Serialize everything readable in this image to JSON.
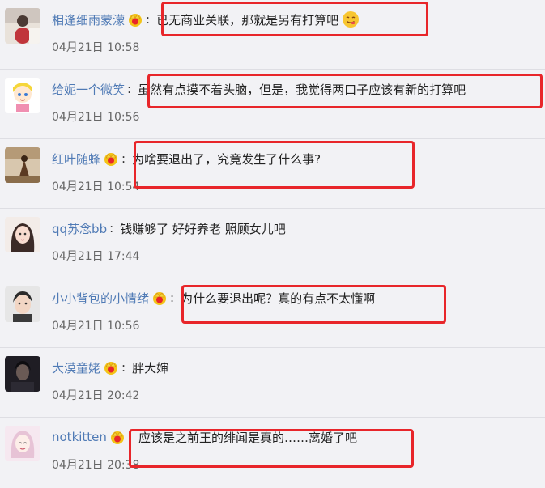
{
  "colors": {
    "username": "#4f7ab5",
    "text": "#222222",
    "timestamp": "#666666",
    "highlight": "#e8262a",
    "background": "#f2f2f5"
  },
  "comments": [
    {
      "user": "相逢细雨蒙濛",
      "crown": true,
      "text": "已无商业关联，那就是另有打算吧",
      "emoji": "yum-emoji",
      "time": "04月21日 10:58",
      "highlighted": true
    },
    {
      "user": "给妮一个微笑",
      "crown": false,
      "text": "虽然有点摸不着头脑，但是，我觉得两口子应该有新的打算吧",
      "time": "04月21日 10:56",
      "highlighted": true
    },
    {
      "user": "红叶随蜂",
      "crown": true,
      "text": "为啥要退出了，究竟发生了什么事?",
      "time": "04月21日 10:54",
      "highlighted": true
    },
    {
      "user": "qq苏念bb",
      "crown": false,
      "text": "钱赚够了 好好养老 照顾女儿吧",
      "time": "04月21日 17:44",
      "highlighted": false
    },
    {
      "user": "小小背包的小情绪",
      "crown": true,
      "text": "为什么要退出呢？真的有点不太懂啊",
      "time": "04月21日 10:56",
      "highlighted": true
    },
    {
      "user": "大漠童姥",
      "crown": true,
      "text": "胖大婶",
      "time": "04月21日 20:42",
      "highlighted": false
    },
    {
      "user": "notkitten",
      "crown": true,
      "text": "应该是之前王的绯闻是真的……离婚了吧",
      "time": "04月21日 20:38",
      "highlighted": true
    }
  ]
}
